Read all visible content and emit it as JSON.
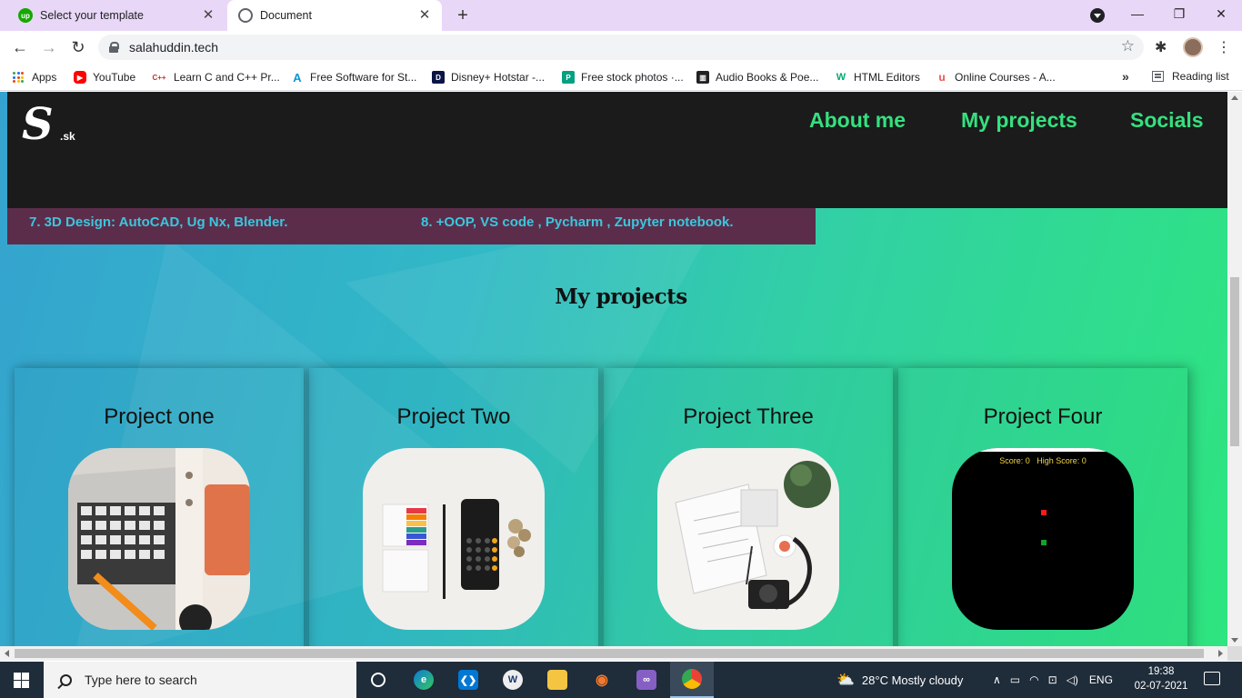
{
  "browser": {
    "tabs": [
      {
        "title": "Select your template",
        "favicon": "upwork-icon"
      },
      {
        "title": "Document",
        "favicon": "globe-icon"
      }
    ],
    "new_tab_symbol": "+",
    "close_symbol": "✕",
    "url": "salahuddin.tech",
    "bookmarks": [
      {
        "label": "Apps",
        "icon": "apps-grid-icon"
      },
      {
        "label": "YouTube",
        "icon": "youtube-icon",
        "color": "#ff0000"
      },
      {
        "label": "Learn C and C++ Pr...",
        "icon": "cpp-icon",
        "color": "#c4302b"
      },
      {
        "label": "Free Software for St...",
        "icon": "autodesk-icon",
        "color": "#0696d7"
      },
      {
        "label": "Disney+ Hotstar -...",
        "icon": "hotstar-icon",
        "color": "#0c1445"
      },
      {
        "label": "Free stock photos ·...",
        "icon": "pexels-icon",
        "color": "#05a081"
      },
      {
        "label": "Audio Books & Poe...",
        "icon": "library-icon",
        "color": "#222222"
      },
      {
        "label": "HTML Editors",
        "icon": "w3-icon",
        "color": "#04aa6d"
      },
      {
        "label": "Online Courses - A...",
        "icon": "udemy-icon",
        "color": "#ec5252"
      }
    ],
    "more_bookmarks": "»",
    "reading_list": "Reading list"
  },
  "site": {
    "logo": {
      "letter": "S",
      "suffix": ".sk"
    },
    "nav": [
      "About me",
      "My projects",
      "Socials"
    ],
    "accent_color": "#35e07f",
    "skills": [
      "7. 3D Design: AutoCAD, Ug Nx, Blender.",
      "8. +OOP, VS code , Pycharm , Zupyter notebook."
    ],
    "projects_heading": "My projects",
    "projects": [
      {
        "title": "Project one",
        "image": "laptop-desk-photo"
      },
      {
        "title": "Project Two",
        "image": "calculator-flatlay-photo"
      },
      {
        "title": "Project Three",
        "image": "sketchbook-camera-photo"
      },
      {
        "title": "Project Four",
        "image": "snake-game-screenshot",
        "score_text": "Score: 0   High Score: 0"
      }
    ]
  },
  "taskbar": {
    "search_placeholder": "Type here to search",
    "weather": "28°C  Mostly cloudy",
    "language": "ENG",
    "time": "19:38",
    "date": "02-07-2021"
  }
}
